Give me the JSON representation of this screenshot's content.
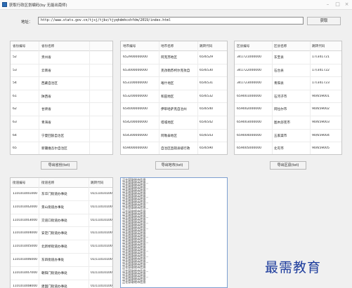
{
  "window": {
    "title": "获取行政区划编码(by 无能出南师)"
  },
  "address": {
    "label": "地址：",
    "url": "http://www.stats.gov.cn/tjsj/tjbz/tjyqhdmhcxhfdm/2019/index.html"
  },
  "fetch_button": "获取",
  "provinces": {
    "headers": [
      "省份编号",
      "省份名称"
    ],
    "rows": [
      [
        "52",
        "贵州省"
      ],
      [
        "53",
        "云南省"
      ],
      [
        "54",
        "西藏自治区"
      ],
      [
        "61",
        "陕西省"
      ],
      [
        "62",
        "甘肃省"
      ],
      [
        "63",
        "青海省"
      ],
      [
        "64",
        "宁夏回族自治区"
      ],
      [
        "65",
        "新疆维吾尔自治区"
      ]
    ],
    "export_label": "导出省份(txt)"
  },
  "cities": {
    "headers": [
      "地市编号",
      "地市名称",
      "跳转代码"
    ],
    "rows": [
      [
        "652900000000",
        "阿克苏地区",
        "65/6529"
      ],
      [
        "653000000000",
        "克孜勒苏柯尔克孜自",
        "65/6530"
      ],
      [
        "653100000000",
        "喀什地区",
        "65/6531"
      ],
      [
        "653200000000",
        "和田地区",
        "65/6532"
      ],
      [
        "654000000000",
        "伊犁哈萨克自治州",
        "65/6540"
      ],
      [
        "654200000000",
        "塔城地区",
        "65/6542"
      ],
      [
        "654300000000",
        "阿勒泰地区",
        "65/6543"
      ],
      [
        "659000000000",
        "自治区直辖县级行政",
        "65/6590"
      ]
    ],
    "export_label": "导出地市(txt)"
  },
  "counties": {
    "headers": [
      "区县编号",
      "区县名称",
      "跳转代码"
    ],
    "rows": [
      [
        "341721000000",
        "东至县",
        "17/341721"
      ],
      [
        "341722000000",
        "石台县",
        "17/341722"
      ],
      [
        "341723000000",
        "青阳县",
        "17/341723"
      ],
      [
        "659001000000",
        "石河子市",
        "90/659001"
      ],
      [
        "659002000000",
        "阿拉尔市",
        "90/659002"
      ],
      [
        "659003000000",
        "图木舒克市",
        "90/659003"
      ],
      [
        "659004000000",
        "五家渠市",
        "90/659004"
      ],
      [
        "659005000000",
        "北屯市",
        "90/659005"
      ]
    ],
    "export_label": "导出区县(txt)"
  },
  "streets": {
    "headers": [
      "街道编号",
      "街道名称",
      "跳转代码"
    ],
    "rows": [
      [
        "110101001000",
        "东华门街道办事处",
        "01/110101001"
      ],
      [
        "110101002000",
        "景山街道办事处",
        "01/110101001"
      ],
      [
        "110101003000",
        "交道口街道办事处",
        "01/110101001"
      ],
      [
        "110101004000",
        "安定门街道办事处",
        "01/110101001"
      ],
      [
        "110101005000",
        "北新桥街道办事处",
        "01/110101001"
      ],
      [
        "110101006000",
        "东四街道办事处",
        "01/110101001"
      ],
      [
        "110101007000",
        "朝阳门街道办事处",
        "01/110101001"
      ],
      [
        "110101008000",
        "建国门街道办事处",
        "01/110101001"
      ]
    ]
  },
  "log_lines": [
    "正在获取地市信息",
    "正在获取地市信息...",
    "正在获取地市信息",
    "正在获取地市信息...",
    "正在获取地市信息",
    "正在获取地市信息",
    "正在获取地市信息...",
    "正在获取地市信息",
    "正在获取地市信息...",
    "正在获取地市信息",
    "正在获取地市信息...",
    "正在获取地市信息",
    "正在获取地市信息",
    "正在获取地市信息...",
    "正在获取地市信息",
    "正在获取地市信息...",
    "正在获取地市信息",
    "正在获取地市信息...",
    "正在获取地市信息",
    "正在获取地市信息",
    "正在获取地市信息...",
    "正在获取地市信息",
    "正在获取地市信息...",
    "正在获取地市信息",
    "正在获取地市信息",
    "正在获取地市信息...",
    "正在获取地市信息",
    "正在获取地市信息...",
    "正在获取地市信息",
    "正在获取地市信息...",
    "正在获取地市信息",
    "正在获取地市信息",
    "正在获取地市信息...",
    "正在获取地市信息",
    "正在获取地市信息...",
    "正在获取地市信息",
    "正在获取地市信息"
  ],
  "watermark": "最需教育"
}
